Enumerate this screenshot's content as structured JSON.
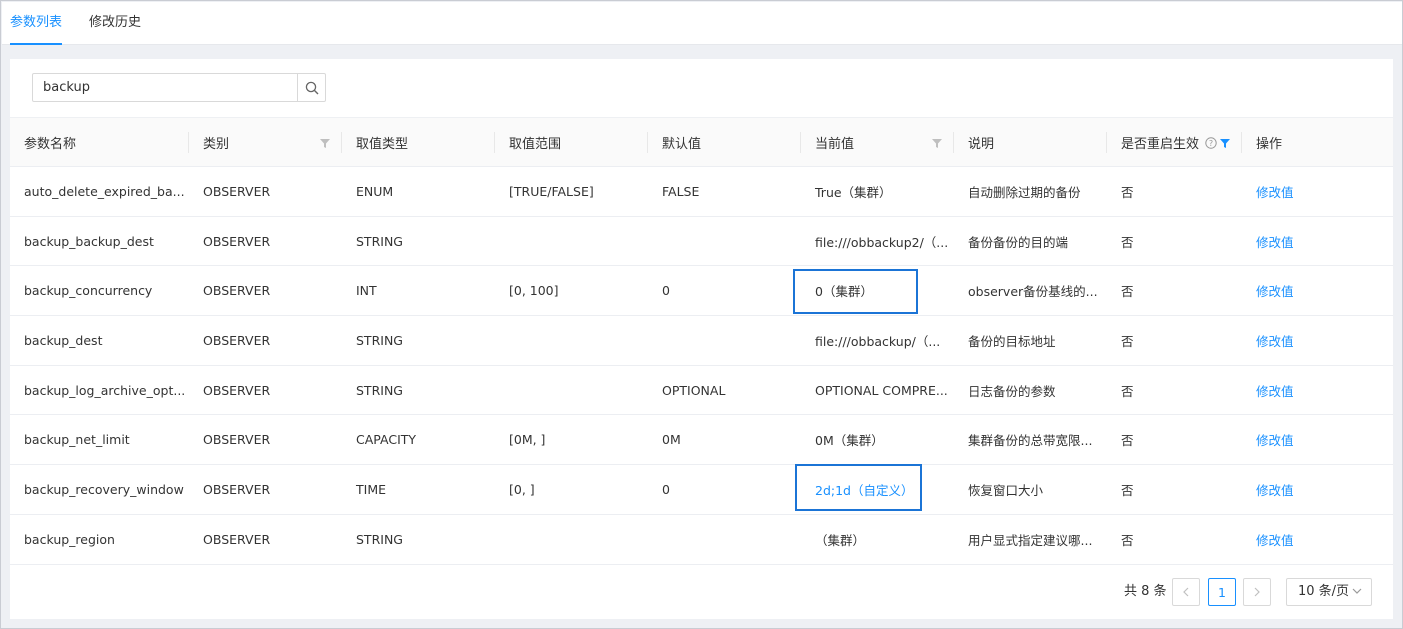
{
  "tabs": [
    {
      "label": "参数列表",
      "active": true
    },
    {
      "label": "修改历史",
      "active": false
    }
  ],
  "search": {
    "value": "backup",
    "icon": "search-icon"
  },
  "columns": [
    {
      "label": "参数名称",
      "filter": false
    },
    {
      "label": "类别",
      "filter": true
    },
    {
      "label": "取值类型",
      "filter": false
    },
    {
      "label": "取值范围",
      "filter": false
    },
    {
      "label": "默认值",
      "filter": false
    },
    {
      "label": "当前值",
      "filter": true
    },
    {
      "label": "说明",
      "filter": false
    },
    {
      "label": "是否重启生效",
      "filter": true,
      "filter_active": true,
      "help_icon": true
    },
    {
      "label": "操作",
      "filter": false
    }
  ],
  "rows": [
    {
      "name": "auto_delete_expired_ba...",
      "category": "OBSERVER",
      "type": "ENUM",
      "range": "[TRUE/FALSE]",
      "default": "FALSE",
      "current": "True（集群）",
      "desc": "自动删除过期的备份",
      "restart": "否",
      "action": "修改值"
    },
    {
      "name": "backup_backup_dest",
      "category": "OBSERVER",
      "type": "STRING",
      "range": "",
      "default": "",
      "current": "file:///obbackup2/（...",
      "desc": "备份备份的目的端",
      "restart": "否",
      "action": "修改值"
    },
    {
      "name": "backup_concurrency",
      "category": "OBSERVER",
      "type": "INT",
      "range": "[0, 100]",
      "default": "0",
      "current": "0（集群）",
      "desc": "observer备份基线的...",
      "restart": "否",
      "action": "修改值"
    },
    {
      "name": "backup_dest",
      "category": "OBSERVER",
      "type": "STRING",
      "range": "",
      "default": "",
      "current": "file:///obbackup/（...",
      "desc": "备份的目标地址",
      "restart": "否",
      "action": "修改值"
    },
    {
      "name": "backup_log_archive_opt...",
      "category": "OBSERVER",
      "type": "STRING",
      "range": "",
      "default": "OPTIONAL",
      "current": "OPTIONAL COMPRE...",
      "desc": "日志备份的参数",
      "restart": "否",
      "action": "修改值"
    },
    {
      "name": "backup_net_limit",
      "category": "OBSERVER",
      "type": "CAPACITY",
      "range": "[0M, ]",
      "default": "0M",
      "current": "0M（集群）",
      "desc": "集群备份的总带宽限...",
      "restart": "否",
      "action": "修改值"
    },
    {
      "name": "backup_recovery_window",
      "category": "OBSERVER",
      "type": "TIME",
      "range": "[0, ]",
      "default": "0",
      "current": "2d;1d（自定义）",
      "desc": "恢复窗口大小",
      "restart": "否",
      "action": "修改值"
    },
    {
      "name": "backup_region",
      "category": "OBSERVER",
      "type": "STRING",
      "range": "",
      "default": "",
      "current": "（集群）",
      "desc": "用户显式指定建议哪...",
      "restart": "否",
      "action": "修改值"
    }
  ],
  "pagination": {
    "total_text": "共 8 条",
    "current_page": "1",
    "page_size": "10 条/页"
  },
  "colors": {
    "accent": "#1890ff",
    "highlight_box": "#1b74d6"
  }
}
